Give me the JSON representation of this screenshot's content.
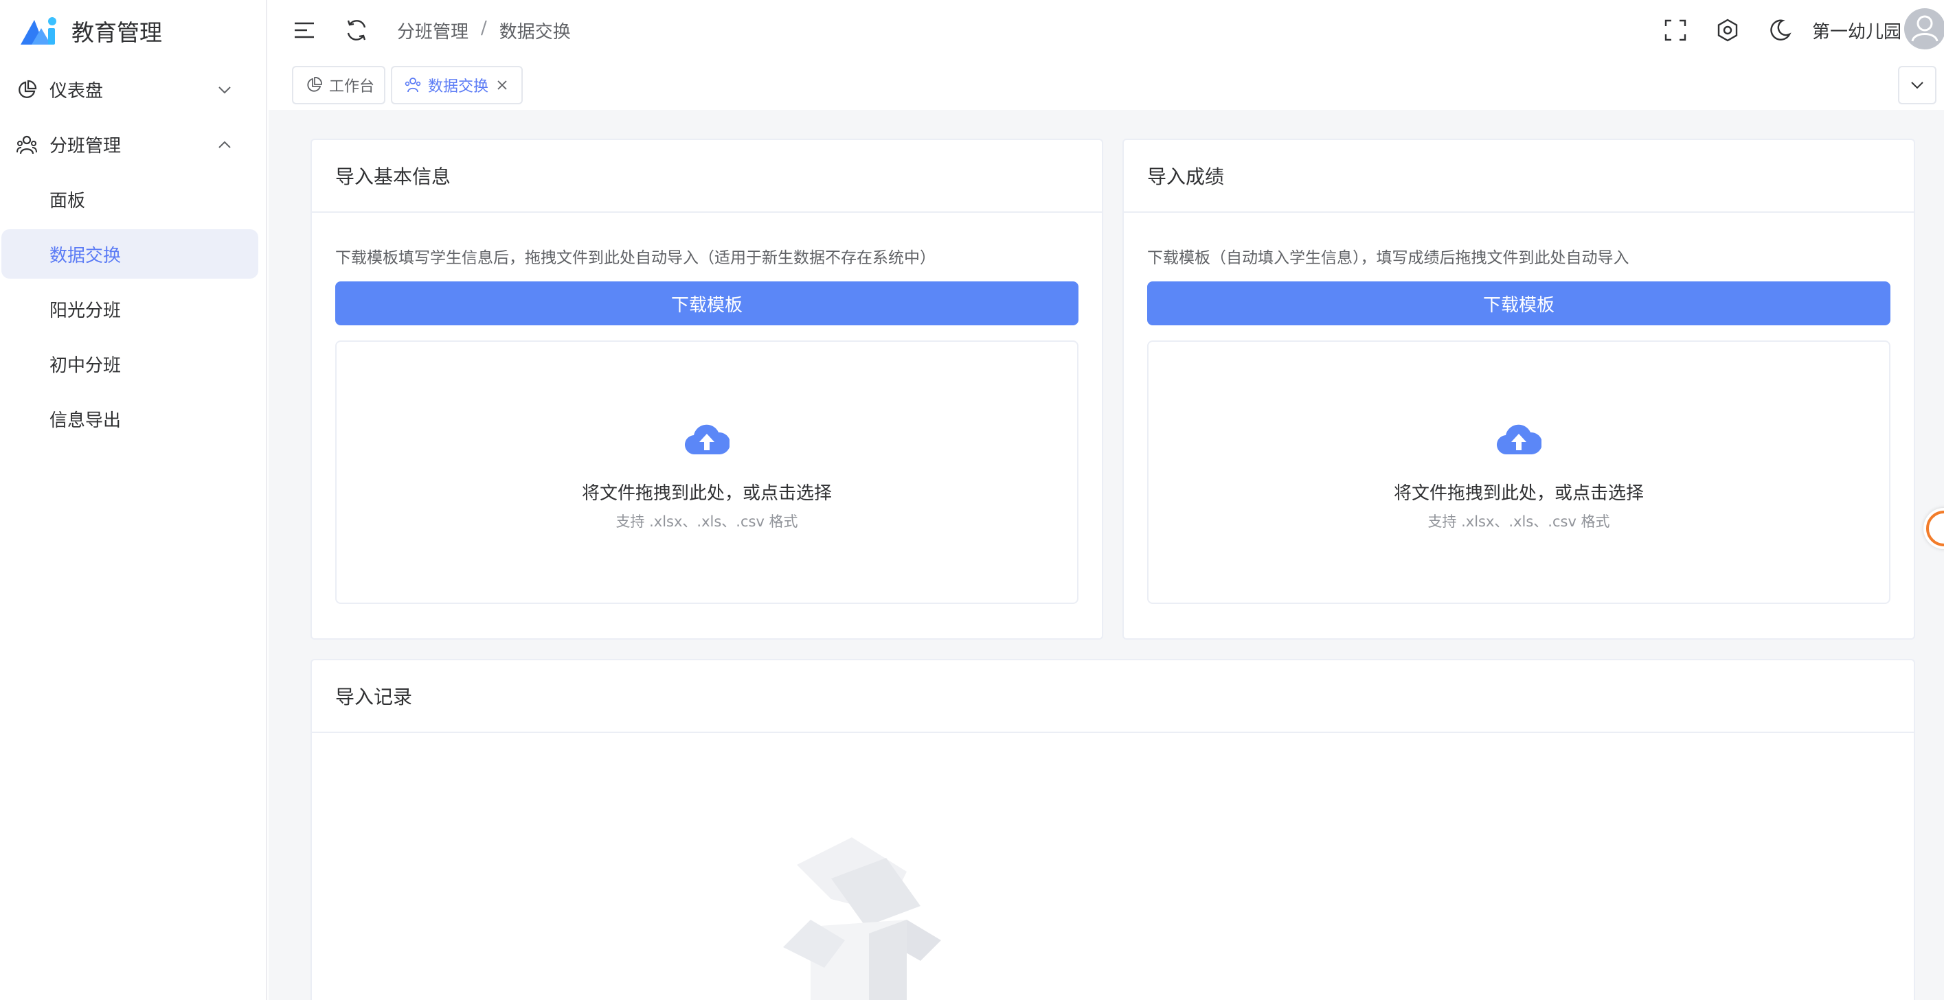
{
  "brand": {
    "title": "教育管理",
    "logo_icon": "mountain-logo-icon"
  },
  "sidebar": {
    "items": [
      {
        "label": "仪表盘",
        "icon": "pie-chart-icon",
        "arrow": "chevron-down-icon"
      },
      {
        "label": "分班管理",
        "icon": "users-icon",
        "arrow": "chevron-up-icon"
      }
    ],
    "submenu": [
      {
        "label": "面板"
      },
      {
        "label": "数据交换",
        "active": true
      },
      {
        "label": "阳光分班"
      },
      {
        "label": "初中分班"
      },
      {
        "label": "信息导出"
      }
    ]
  },
  "header": {
    "breadcrumb": [
      "分班管理",
      "数据交换"
    ],
    "breadcrumb_sep": "/",
    "user_name": "第一幼儿园"
  },
  "tabs": [
    {
      "label": "工作台",
      "icon": "pie-chart-icon"
    },
    {
      "label": "数据交换",
      "icon": "users-icon",
      "active": true
    }
  ],
  "cards": {
    "basic": {
      "title": "导入基本信息",
      "desc": "下载模板填写学生信息后，拖拽文件到此处自动导入（适用于新生数据不存在系统中）",
      "button": "下载模板",
      "drop_main": "将文件拖拽到此处，或点击选择",
      "drop_sub": "支持 .xlsx、.xls、.csv 格式"
    },
    "scores": {
      "title": "导入成绩",
      "desc": "下载模板（自动填入学生信息），填写成绩后拖拽文件到此处自动导入",
      "button": "下载模板",
      "drop_main": "将文件拖拽到此处，或点击选择",
      "drop_sub": "支持 .xlsx、.xls、.csv 格式"
    },
    "records": {
      "title": "导入记录"
    }
  },
  "colors": {
    "primary": "#5b87f7",
    "active_text": "#5b7bf5",
    "active_bg": "#eceff9"
  }
}
